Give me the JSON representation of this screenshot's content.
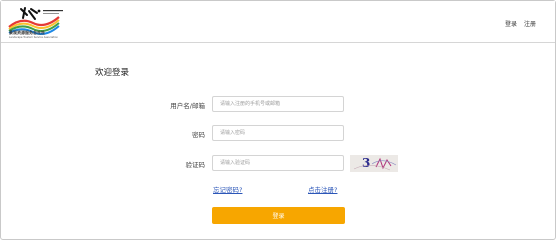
{
  "header": {
    "logo_name": "景观资源服务总社社",
    "logo_subtitle": "Landscape Tourism Service Association",
    "nav_login": "登录",
    "nav_register": "注册"
  },
  "form": {
    "title": "欢迎登录",
    "username_label": "用户名/邮箱",
    "username_placeholder": "请输入注册的手机号或邮箱",
    "password_label": "密码",
    "password_placeholder": "请输入密码",
    "captcha_label": "验证码",
    "captcha_placeholder": "请输入验证码",
    "captcha_text": "3",
    "forgot_link": "忘记密码?",
    "register_link": "点击注册?",
    "submit_label": "登录"
  },
  "colors": {
    "accent": "#f7a600",
    "link": "#2b56b8"
  }
}
